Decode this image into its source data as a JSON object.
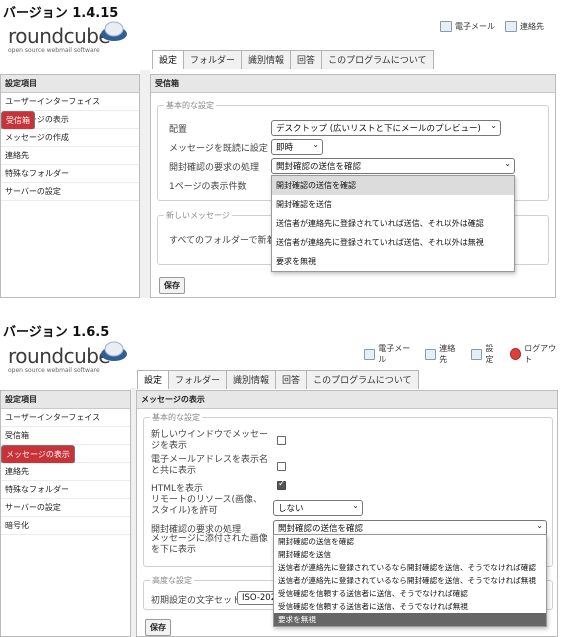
{
  "headings": {
    "v1": "バージョン 1.4.15",
    "v2": "バージョン 1.6.5"
  },
  "logo": {
    "word": "roundcube",
    "sub": "open source webmail software"
  },
  "v1": {
    "topbar": [
      {
        "label": "電子メール",
        "icon": "mail-icon"
      },
      {
        "label": "連絡先",
        "icon": "contacts-icon"
      }
    ],
    "tabs": [
      "設定",
      "フォルダー",
      "識別情報",
      "回答",
      "このプログラムについて"
    ],
    "sidebar_header": "設定項目",
    "sidebar_items": [
      "ユーザーインターフェイス",
      "受信箱",
      "メッセージの表示",
      "メッセージの作成",
      "連絡先",
      "特殊なフォルダー",
      "サーバーの設定"
    ],
    "main_header": "受信箱",
    "basic_legend": "基本的な設定",
    "rows": {
      "layout_label": "配置",
      "layout_value": "デスクトップ (広いリストと下にメールのプレビュー)",
      "mark_read_label": "メッセージを既読に設定",
      "mark_read_value": "即時",
      "mdn_label": "開封確認の要求の処理",
      "mdn_value": "開封確認の送信を確認",
      "rows_label": "1ページの表示件数"
    },
    "dropdown_options": [
      "開封確認の送信を確認",
      "開封確認を送信",
      "送信者が連絡先に登録されていれば送信、それ以外は確認",
      "送信者が連絡先に登録されていれば送信、それ以外は無視",
      "要求を無視"
    ],
    "new_legend": "新しいメッセージ",
    "new_label": "すべてのフォルダーで新着",
    "save": "保存"
  },
  "v2": {
    "topbar": [
      {
        "label": "電子メール",
        "icon": "mail-icon"
      },
      {
        "label": "連絡先",
        "icon": "contacts-icon"
      },
      {
        "label": "設定",
        "icon": "settings-icon"
      },
      {
        "label": "ログアウト",
        "icon": "logout-icon"
      }
    ],
    "tabs": [
      "設定",
      "フォルダー",
      "識別情報",
      "回答",
      "このプログラムについて"
    ],
    "sidebar_header": "設定項目",
    "sidebar_items": [
      "ユーザーインターフェイス",
      "受信箱",
      "メッセージの表示",
      "メッセージの作成",
      "連絡先",
      "特殊なフォルダー",
      "サーバーの設定",
      "暗号化"
    ],
    "main_header": "メッセージの表示",
    "basic_legend": "基本的な設定",
    "rows": {
      "new_window_label": "新しいウインドウでメッセージを表示",
      "email_name_label": "電子メールアドレスを表示名と共に表示",
      "html_label": "HTMLを表示",
      "remote_label": "リモートのリソース(画像、スタイル)を許可",
      "remote_value": "しない",
      "mdn_label": "開封確認の要求の処理",
      "mdn_value": "開封確認の送信を確認",
      "attach_label": "メッセージに添付された画像を下に表示"
    },
    "checks": {
      "new_window": false,
      "email_name": false,
      "html": true
    },
    "dropdown_options": [
      "開封確認の送信を確認",
      "開封確認を送信",
      "送信者が連絡先に登録されているなら開封確認を送信、そうでなければ確認",
      "送信者が連絡先に登録されているなら開封確認を送信、そうでなければ無視",
      "受信確認を信頼する送信者に送信、そうでなければ確認",
      "受信確認を信頼する送信者に送信、そうでなければ無視",
      "要求を無視"
    ],
    "adv_legend": "高度な設定",
    "charset_label": "初期設定の文字セット",
    "charset_value": "ISO-202",
    "save": "保存"
  },
  "colors": {
    "accent": "#c8333a",
    "header_bg": "#e7e7e7"
  }
}
